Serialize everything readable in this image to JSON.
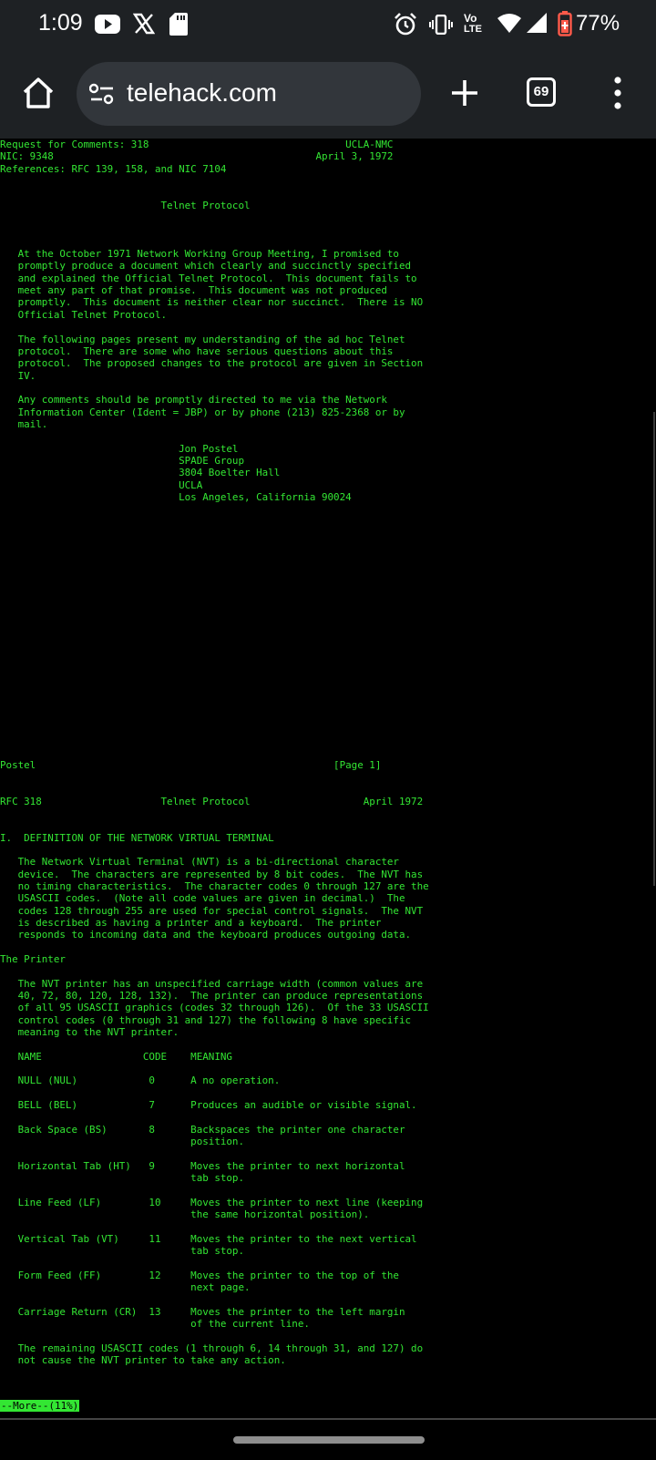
{
  "status_bar": {
    "time": "1:09",
    "battery": "77%",
    "network_label_top": "Vo",
    "network_label_bottom": "LTE"
  },
  "browser": {
    "url": "telehack.com",
    "tab_count": "69"
  },
  "terminal": {
    "text": "Request for Comments: 318                                 UCLA-NMC\nNIC: 9348                                            April 3, 1972\nReferences: RFC 139, 158, and NIC 7104\n\n\n                           Telnet Protocol\n\n\n\n   At the October 1971 Network Working Group Meeting, I promised to\n   promptly produce a document which clearly and succinctly specified\n   and explained the Official Telnet Protocol.  This document fails to\n   meet any part of that promise.  This document was not produced\n   promptly.  This document is neither clear nor succinct.  There is NO\n   Official Telnet Protocol.\n\n   The following pages present my understanding of the ad hoc Telnet\n   protocol.  There are some who have serious questions about this\n   protocol.  The proposed changes to the protocol are given in Section\n   IV.\n\n   Any comments should be promptly directed to me via the Network\n   Information Center (Ident = JBP) or by phone (213) 825-2368 or by\n   mail.\n\n                              Jon Postel\n                              SPADE Group\n                              3804 Boelter Hall\n                              UCLA\n                              Los Angeles, California 90024\n\n\n\n\n\n\n\n\n\n\n\n\n\n\n\n\n\n\n\n\n\nPostel                                                  [Page 1]\n\n\nRFC 318                    Telnet Protocol                   April 1972\n\n\nI.  DEFINITION OF THE NETWORK VIRTUAL TERMINAL\n\n   The Network Virtual Terminal (NVT) is a bi-directional character\n   device.  The characters are represented by 8 bit codes.  The NVT has\n   no timing characteristics.  The character codes 0 through 127 are the\n   USASCII codes.  (Note all code values are given in decimal.)  The\n   codes 128 through 255 are used for special control signals.  The NVT\n   is described as having a printer and a keyboard.  The printer\n   responds to incoming data and the keyboard produces outgoing data.\n\nThe Printer\n\n   The NVT printer has an unspecified carriage width (common values are\n   40, 72, 80, 120, 128, 132).  The printer can produce representations\n   of all 95 USASCII graphics (codes 32 through 126).  Of the 33 USASCII\n   control codes (0 through 31 and 127) the following 8 have specific\n   meaning to the NVT printer.\n\n   NAME                 CODE    MEANING\n\n   NULL (NUL)            0      A no operation.\n\n   BELL (BEL)            7      Produces an audible or visible signal.\n\n   Back Space (BS)       8      Backspaces the printer one character\n                                position.\n\n   Horizontal Tab (HT)   9      Moves the printer to next horizontal\n                                tab stop.\n\n   Line Feed (LF)        10     Moves the printer to next line (keeping\n                                the same horizontal position).\n\n   Vertical Tab (VT)     11     Moves the printer to the next vertical\n                                tab stop.\n\n   Form Feed (FF)        12     Moves the printer to the top of the\n                                next page.\n\n   Carriage Return (CR)  13     Moves the printer to the left margin\n                                of the current line.\n\n   The remaining USASCII codes (1 through 6, 14 through 31, and 127) do\n   not cause the NVT printer to take any action.",
    "more_prompt": "--More--(11%)"
  },
  "colors": {
    "terminal_fg": "#33e633",
    "terminal_bg": "#000000",
    "chrome_bg": "#1e2124",
    "urlbar_bg": "#32363b"
  },
  "icons": [
    "youtube-icon",
    "x-icon",
    "sd-card-icon",
    "alarm-icon",
    "vibrate-icon",
    "wifi-icon",
    "cell-signal-icon",
    "battery-saver-icon",
    "home-icon",
    "site-settings-icon",
    "plus-icon",
    "tab-switcher-icon",
    "more-vert-icon"
  ]
}
